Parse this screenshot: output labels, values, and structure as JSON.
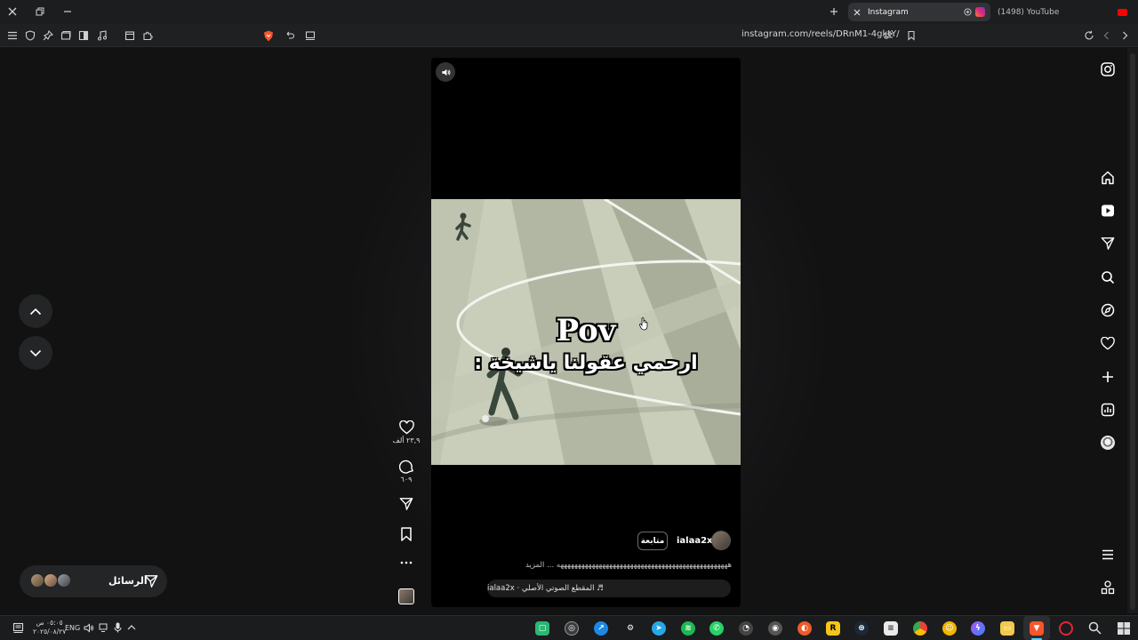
{
  "window": {
    "tabs": [
      {
        "label": "Instagram",
        "active": true
      },
      {
        "label": "(1498) YouTube",
        "active": false
      }
    ]
  },
  "toolbar": {
    "url": "instagram.com/reels/DRnM1-4gktY/"
  },
  "reel": {
    "caption_en": "Pov",
    "caption_ar": "ارحمي عقولنا ياشيخة :",
    "username": "ialaa2x",
    "follow_label": "متابعة",
    "description": "هههههههههههههههههههههههههههههههههههههههههههههههههه ... المزيد",
    "audio": "♬ المقطع الصوتي الأصلي · ialaa2x"
  },
  "actions": {
    "likes": "٢٣,٩ ألف",
    "comments": "٦٠٩"
  },
  "messages": {
    "label": "الرسائل"
  },
  "taskbar": {
    "time": "٠٥:٠٥ ص",
    "date": "٢٠٢٥/٠٨/٢٧",
    "lang": "ENG"
  },
  "colors": {
    "page_bg": "#121213",
    "panel_bg": "#242526",
    "accent_red": "#e0245e"
  }
}
